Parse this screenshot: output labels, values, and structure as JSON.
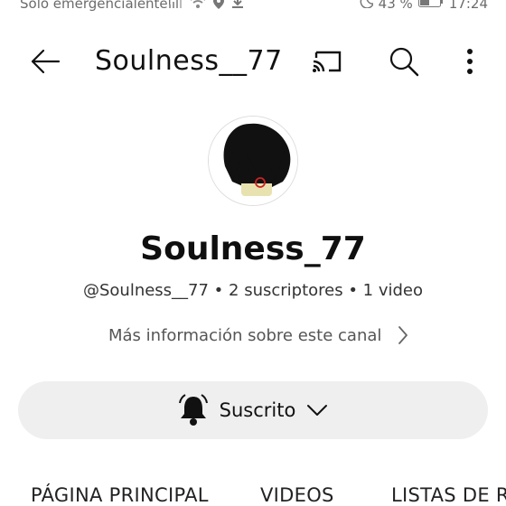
{
  "status_bar": {
    "carrier": "Solo emergencialentel",
    "battery": "43 %",
    "time": "17:24",
    "icons": [
      "signal-icon",
      "wifi-icon",
      "location-icon",
      "download-icon",
      "moon-icon",
      "battery-icon"
    ]
  },
  "app_bar": {
    "title": "Soulness__77",
    "icons": [
      "back-arrow-icon",
      "cast-icon",
      "search-icon",
      "more-vert-icon"
    ]
  },
  "channel": {
    "name": "Soulness_77",
    "meta": "@Soulness__77 • 2 suscriptores • 1 video",
    "more_info": "Más información sobre este canal"
  },
  "subscribe": {
    "label": "Suscrito"
  },
  "tabs": {
    "home": "PÁGINA PRINCIPAL",
    "videos": "VIDEOS",
    "playlists": "LISTAS DE REPRODUCCIÓN"
  },
  "colors": {
    "background": "#ffffff",
    "text": "#0f0f0f",
    "subscribe_bg": "#efefef",
    "avatar_hair": "#111111",
    "avatar_eye": "#cc2222"
  }
}
